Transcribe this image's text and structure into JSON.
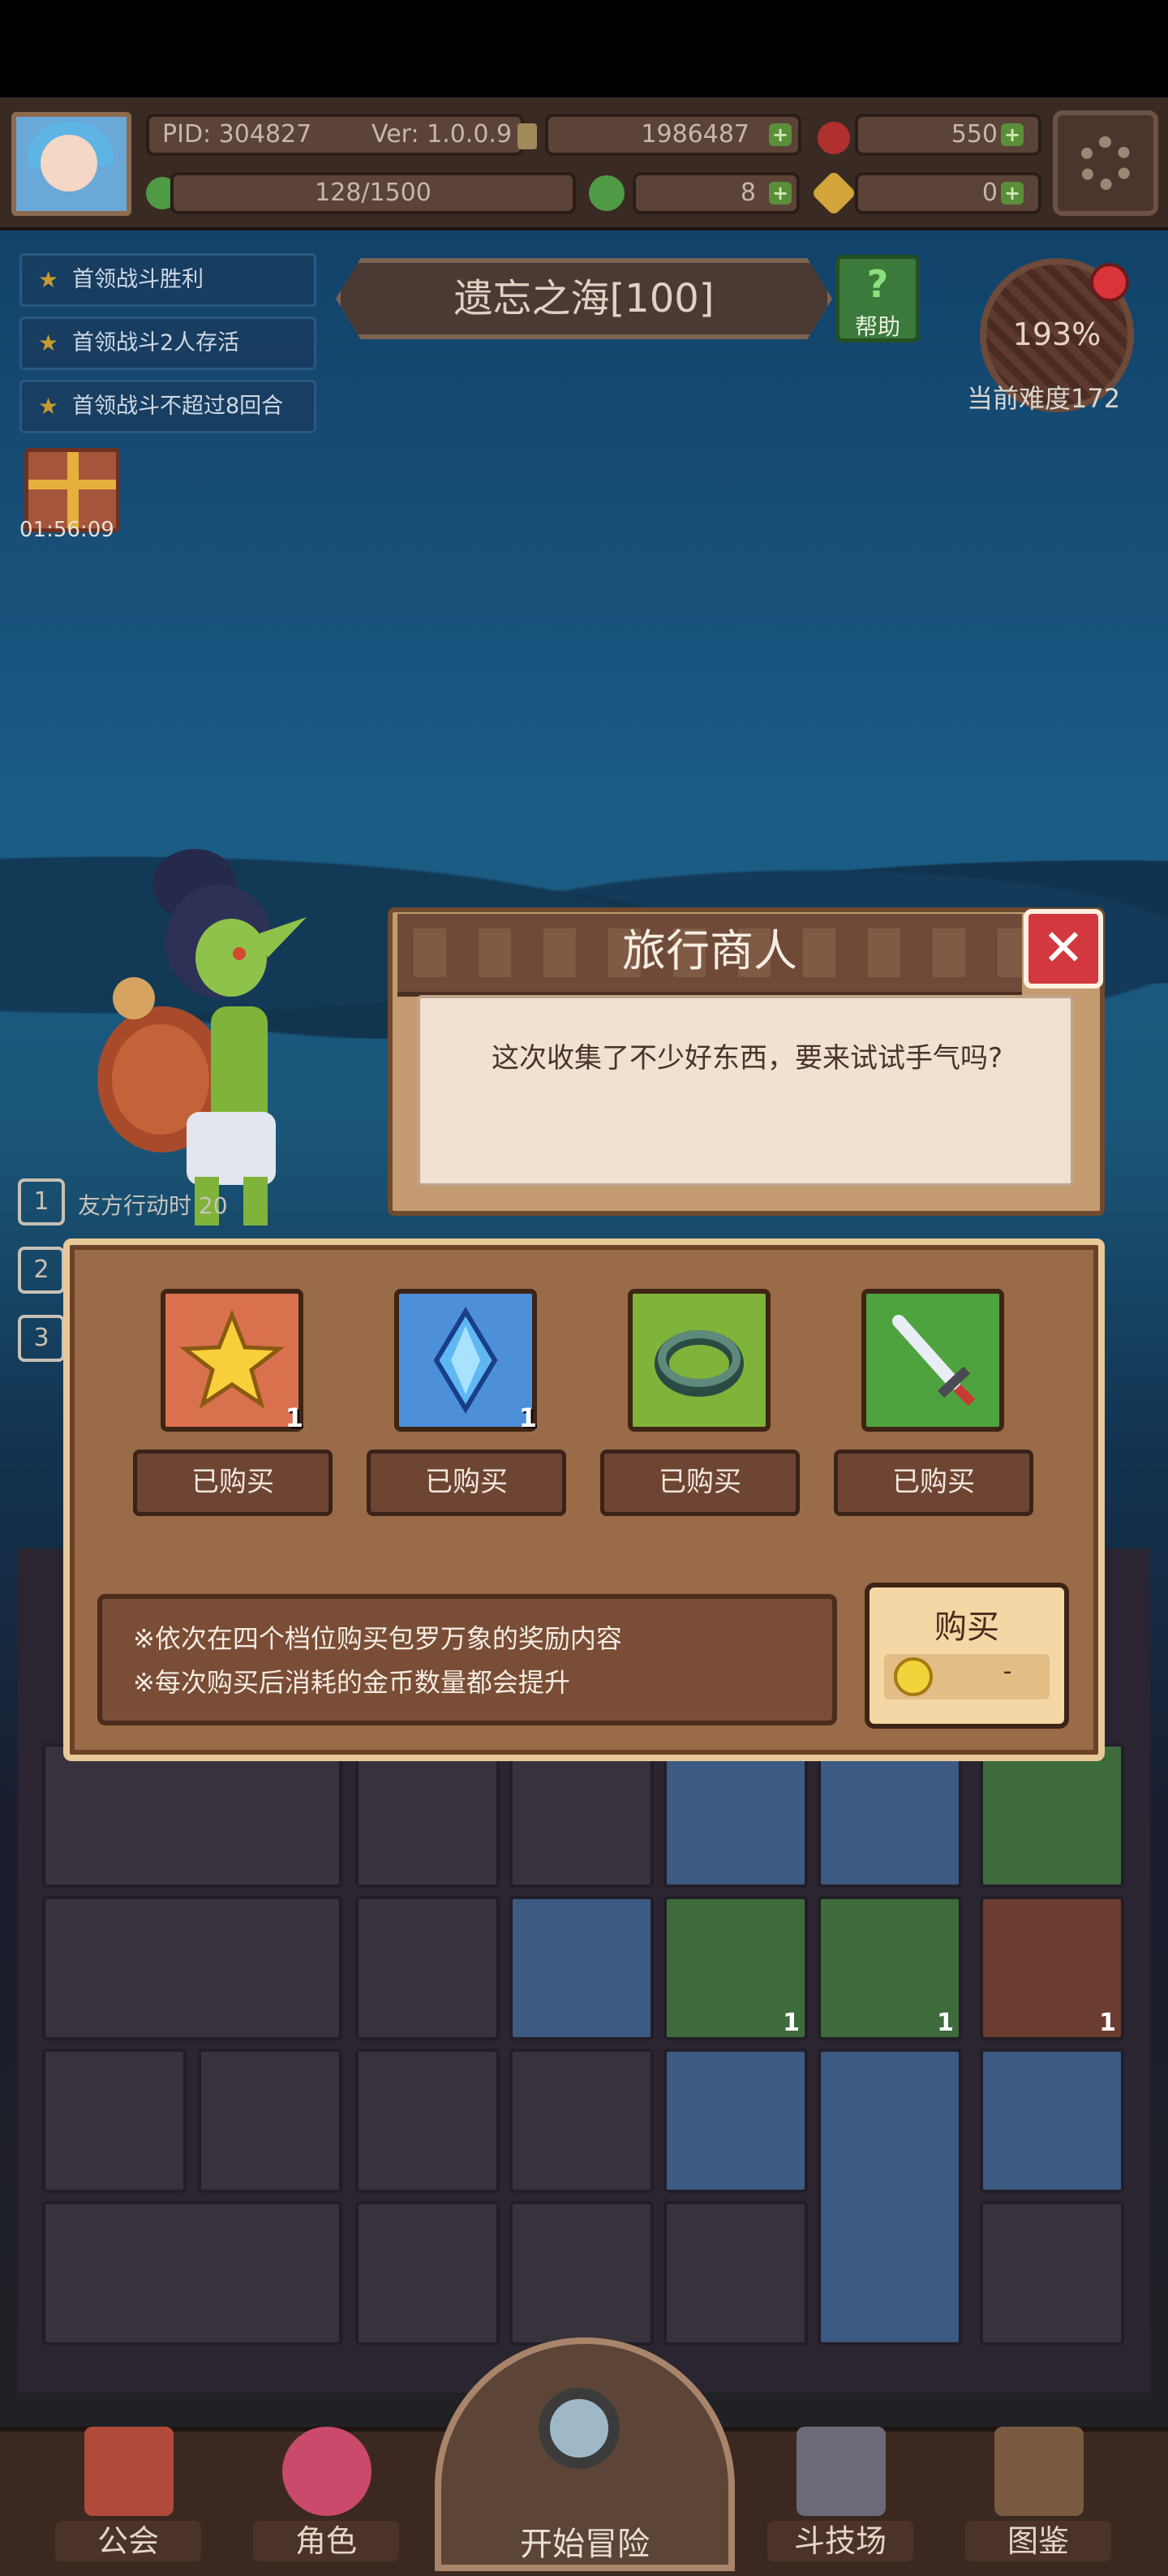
{
  "topbar": {
    "pid": "PID: 304827",
    "version": "Ver: 1.0.0.9",
    "gold": "1986487",
    "gems": "550",
    "stamina": "128/1500",
    "clover": "8",
    "key": "0"
  },
  "quests": [
    "首领战斗胜利",
    "首领战斗2人存活",
    "首领战斗不超过8回合"
  ],
  "gift_timer": "01:56:09",
  "stage": {
    "title": "遗忘之海[100]",
    "help": "帮助",
    "help_glyph": "?"
  },
  "difficulty": {
    "percent": "193%",
    "label": "当前难度172"
  },
  "side_list": {
    "numbers": [
      "1",
      "2",
      "3"
    ],
    "friend_text": "友方行动时 20"
  },
  "dialog": {
    "title": "旅行商人",
    "close": "✕",
    "text": "这次收集了不少好东西，要来试试手气吗?"
  },
  "shop": {
    "items": [
      {
        "icon": "star-icon",
        "count": "1",
        "status": "已购买",
        "color": "#d9714e"
      },
      {
        "icon": "crystal-icon",
        "count": "1",
        "status": "已购买",
        "color": "#4e8fd9"
      },
      {
        "icon": "ring-icon",
        "count": "",
        "status": "已购买",
        "color": "#7fb33a"
      },
      {
        "icon": "sword-icon",
        "count": "",
        "status": "已购买",
        "color": "#4fa33f"
      }
    ],
    "rules": [
      "※依次在四个档位购买包罗万象的奖励内容",
      "※每次购买后消耗的金币数量都会提升"
    ],
    "buy_label": "购买",
    "price": "-"
  },
  "inventory": {
    "counts": [
      "1",
      "1",
      "1"
    ]
  },
  "nav": {
    "guild": "公会",
    "character": "角色",
    "start": "开始冒险",
    "arena": "斗技场",
    "codex": "图鉴"
  },
  "colors": {
    "panel": "#9a6b48",
    "dialog_header": "#6f4a38",
    "close_red": "#d2383e",
    "buy_yellow": "#f4d7a4"
  }
}
